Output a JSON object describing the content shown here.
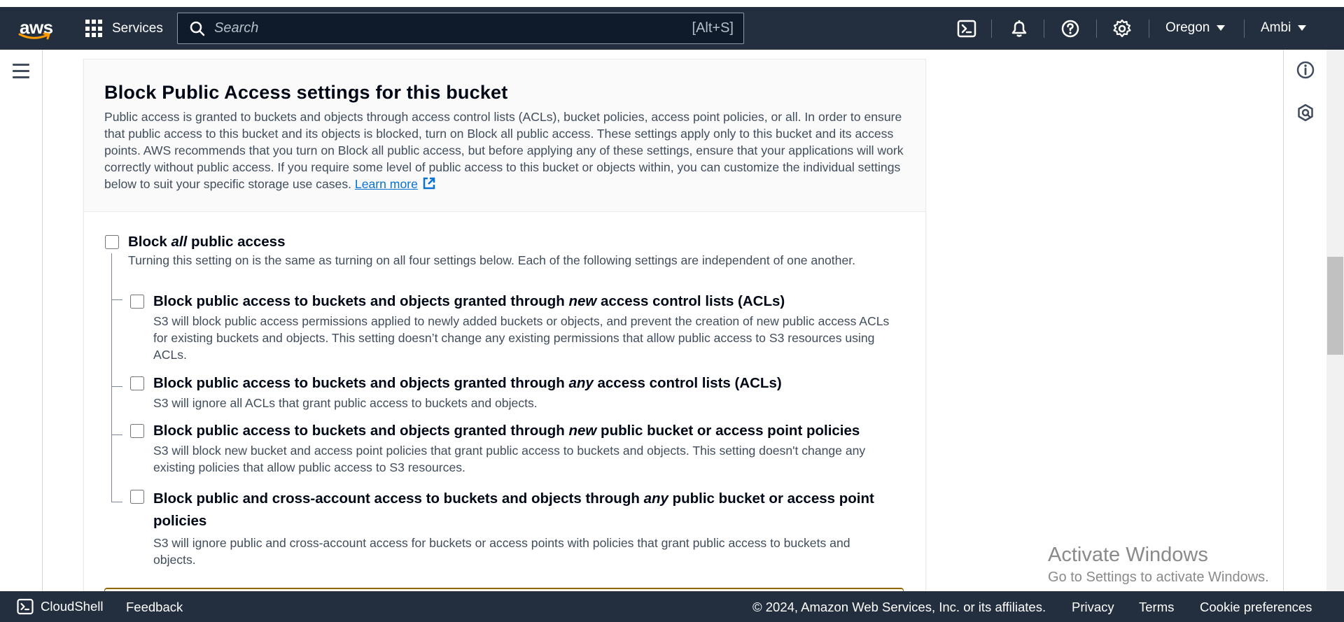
{
  "nav": {
    "logo_text": "aws",
    "services_label": "Services",
    "search_placeholder": "Search",
    "search_shortcut": "[Alt+S]",
    "region_label": "Oregon",
    "user_label": "Ambi"
  },
  "panel": {
    "title": "Block Public Access settings for this bucket",
    "description": "Public access is granted to buckets and objects through access control lists (ACLs), bucket policies, access point policies, or all. In order to ensure that public access to this bucket and its objects is blocked, turn on Block all public access. These settings apply only to this bucket and its access points. AWS recommends that you turn on Block all public access, but before applying any of these settings, ensure that your applications will work correctly without public access. If you require some level of public access to this bucket or objects within, you can customize the individual settings below to suit your specific storage use cases.",
    "learn_more": "Learn more"
  },
  "block_all": {
    "title_pre": "Block ",
    "title_em": "all",
    "title_post": " public access",
    "description": "Turning this setting on is the same as turning on all four settings below. Each of the following settings are independent of one another.",
    "checked": false
  },
  "options": [
    {
      "title_pre": "Block public access to buckets and objects granted through ",
      "title_em": "new",
      "title_post": " access control lists (ACLs)",
      "description": "S3 will block public access permissions applied to newly added buckets or objects, and prevent the creation of new public access ACLs for existing buckets and objects. This setting doesn’t change any existing permissions that allow public access to S3 resources using ACLs.",
      "checked": false
    },
    {
      "title_pre": "Block public access to buckets and objects granted through ",
      "title_em": "any",
      "title_post": " access control lists (ACLs)",
      "description": "S3 will ignore all ACLs that grant public access to buckets and objects.",
      "checked": false
    },
    {
      "title_pre": "Block public access to buckets and objects granted through ",
      "title_em": "new",
      "title_post": " public bucket or access point policies",
      "description": "S3 will block new bucket and access point policies that grant public access to buckets and objects. This setting doesn't change any existing policies that allow public access to S3 resources.",
      "checked": false
    },
    {
      "title_pre": "Block public and cross-account access to buckets and objects through ",
      "title_em": "any",
      "title_post": " public bucket or access point policies",
      "description": "S3 will ignore public and cross-account access for buckets or access points with policies that grant public access to buckets and objects.",
      "checked": false
    }
  ],
  "watermark": {
    "line1": "Activate Windows",
    "line2": "Go to Settings to activate Windows."
  },
  "footer": {
    "cloudshell": "CloudShell",
    "feedback": "Feedback",
    "copyright": "© 2024, Amazon Web Services, Inc. or its affiliates.",
    "privacy": "Privacy",
    "terms": "Terms",
    "cookie": "Cookie preferences"
  },
  "colors": {
    "nav_bg": "#232f3e",
    "link": "#0972d3",
    "text_secondary": "#414d5c",
    "warning_border": "#8d6605"
  }
}
